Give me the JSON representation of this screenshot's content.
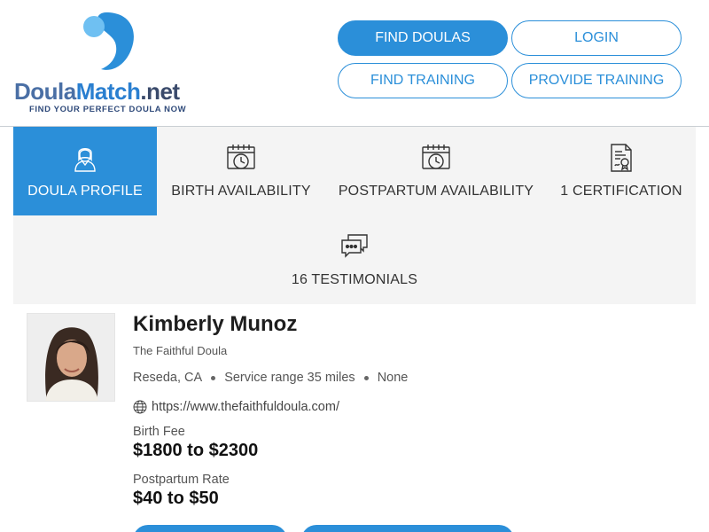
{
  "brand": {
    "name_part1": "Doula",
    "name_part2": "Match",
    "name_part3": ".net",
    "tagline": "FIND YOUR PERFECT DOULA NOW",
    "colors": {
      "primary": "#2b8fd9",
      "light": "#6fc0f2"
    }
  },
  "nav": {
    "find_doulas": "FIND DOULAS",
    "login": "LOGIN",
    "find_training": "FIND TRAINING",
    "provide_training": "PROVIDE TRAINING"
  },
  "tabs": [
    {
      "label": "DOULA PROFILE",
      "icon": "doula-person-icon",
      "active": true
    },
    {
      "label": "BIRTH AVAILABILITY",
      "icon": "calendar-clock-icon",
      "active": false
    },
    {
      "label": "POSTPARTUM AVAILABILITY",
      "icon": "calendar-clock-icon",
      "active": false
    },
    {
      "label": "1 CERTIFICATION",
      "icon": "certificate-icon",
      "active": false
    },
    {
      "label": "16 TESTIMONIALS",
      "icon": "chat-bubbles-icon",
      "active": false
    }
  ],
  "profile": {
    "name": "Kimberly Munoz",
    "business": "The Faithful Doula",
    "location": "Reseda, CA",
    "service_range": "Service range 35 miles",
    "extra": "None",
    "website": "https://www.thefaithfuldoula.com/",
    "birth_fee_label": "Birth Fee",
    "birth_fee": "$1800 to $2300",
    "postpartum_label": "Postpartum Rate",
    "postpartum_rate": "$40 to $50"
  }
}
